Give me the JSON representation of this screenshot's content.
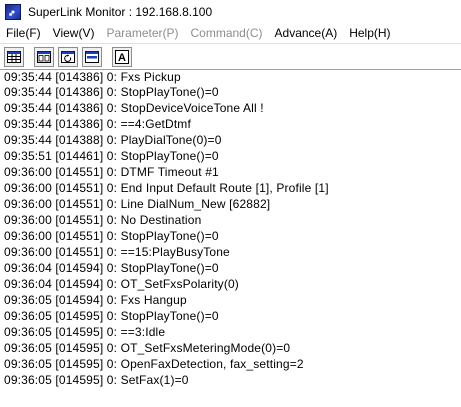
{
  "window": {
    "title": "SuperLink Monitor : 192.168.8.100"
  },
  "menu": [
    {
      "label": "File(F)",
      "enabled": true
    },
    {
      "label": "View(V)",
      "enabled": true
    },
    {
      "label": "Parameter(P)",
      "enabled": false
    },
    {
      "label": "Command(C)",
      "enabled": false
    },
    {
      "label": "Advance(A)",
      "enabled": true
    },
    {
      "label": "Help(H)",
      "enabled": true
    }
  ],
  "toolbar": {
    "buttons": [
      "table-grid-icon",
      "split-window-icon",
      "refresh-window-icon",
      "window-bar-icon",
      "font-a-icon"
    ],
    "font_button_label": "A"
  },
  "log": {
    "lines": [
      "09:35:44 [014386] 0: Fxs Pickup",
      "09:35:44 [014386] 0: StopPlayTone()=0",
      "09:35:44 [014386] 0: StopDeviceVoiceTone All !",
      "09:35:44 [014386] 0: ==4:GetDtmf",
      "09:35:44 [014388] 0: PlayDialTone(0)=0",
      "09:35:51 [014461] 0: StopPlayTone()=0",
      "09:36:00 [014551] 0: DTMF Timeout #1",
      "09:36:00 [014551] 0: End Input Default Route [1], Profile [1]",
      "09:36:00 [014551] 0: Line DialNum_New [62882]",
      "09:36:00 [014551] 0: No Destination",
      "09:36:00 [014551] 0: StopPlayTone()=0",
      "09:36:00 [014551] 0: ==15:PlayBusyTone",
      "09:36:04 [014594] 0: StopPlayTone()=0",
      "09:36:04 [014594] 0: OT_SetFxsPolarity(0)",
      "09:36:05 [014594] 0: Fxs Hangup",
      "09:36:05 [014595] 0: StopPlayTone()=0",
      "09:36:05 [014595] 0: ==3:Idle",
      "09:36:05 [014595] 0: OT_SetFxsMeteringMode(0)=0",
      "09:36:05 [014595] 0: OpenFaxDetection, fax_setting=2",
      "09:36:05 [014595] 0: SetFax(1)=0"
    ]
  }
}
